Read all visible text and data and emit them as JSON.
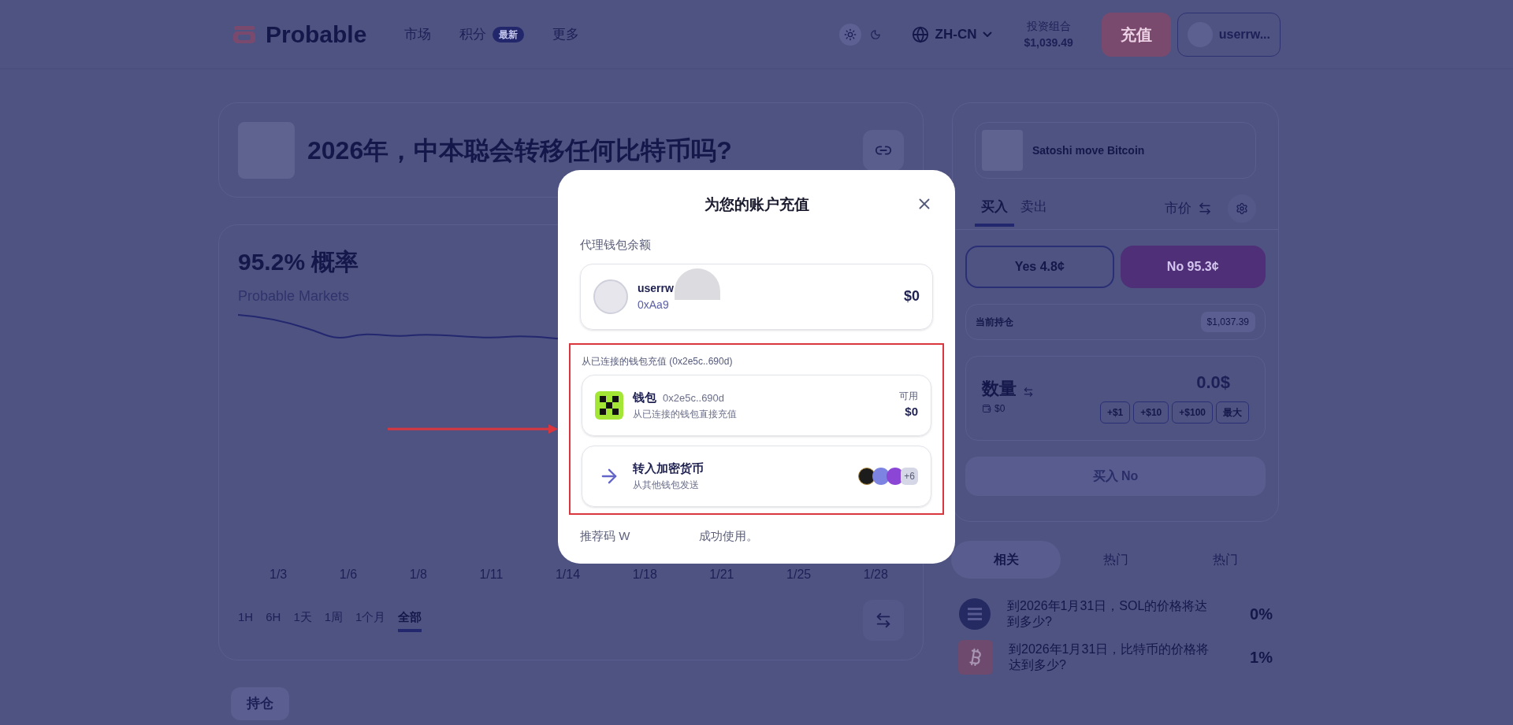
{
  "header": {
    "logo": "Probable",
    "nav": [
      {
        "label": "市场"
      },
      {
        "label": "积分",
        "badge": "最新"
      },
      {
        "label": "更多"
      }
    ],
    "dark_theme": false,
    "language": "ZH-CN",
    "portfolio_label": "投资组合",
    "portfolio_value": "$1,039.49",
    "deposit": "充值",
    "user": "userrw..."
  },
  "market": {
    "title": "2026年，中本聪会转移任何比特币吗?",
    "probability": "95.2% 概率",
    "chart_watermark": "Probable Markets",
    "x_labels": [
      "1/3",
      "1/6",
      "1/8",
      "1/11",
      "1/14",
      "1/18",
      "1/21",
      "1/25",
      "1/28"
    ],
    "ranges": [
      {
        "label": "1H",
        "selected": false
      },
      {
        "label": "6H",
        "selected": false
      },
      {
        "label": "1天",
        "selected": false
      },
      {
        "label": "1周",
        "selected": false
      },
      {
        "label": "1个月",
        "selected": false
      },
      {
        "label": "全部",
        "selected": true
      }
    ],
    "positions_tab": "持仓"
  },
  "trade": {
    "title": "Satoshi move Bitcoin",
    "sides": [
      {
        "label": "买入",
        "selected": true
      },
      {
        "label": "卖出",
        "selected": false
      }
    ],
    "order_type": "市价",
    "outcomes": [
      {
        "label": "Yes 4.8¢",
        "selected": false
      },
      {
        "label": "No 95.3¢",
        "selected": true
      }
    ],
    "holding_label": "当前持仓",
    "holding_value": "$1,037.39",
    "amount_label": "数量",
    "balance": "$0",
    "amount": "0.0$",
    "quick": [
      "+$1",
      "+$10",
      "+$100",
      "最大"
    ],
    "submit": "买入 No"
  },
  "related": {
    "tabs": [
      {
        "label": "相关",
        "selected": true
      },
      {
        "label": "热门",
        "selected": false
      },
      {
        "label": "热门",
        "selected": false
      }
    ],
    "items": [
      {
        "kind": "sol",
        "question": "到2026年1月31日，SOL的价格将达到多少?",
        "percent": "0%"
      },
      {
        "kind": "btc",
        "question": "到2026年1月31日，比特币的价格将达到多少?",
        "percent": "1%"
      }
    ]
  },
  "modal": {
    "title": "为您的账户充值",
    "proxy_label": "代理钱包余额",
    "account": {
      "name": "userrw",
      "address": "0xAa9",
      "balance": "$0"
    },
    "connected_label": "从已连接的钱包充值 (0x2e5c..690d)",
    "options": [
      {
        "kind": "wallet",
        "title": "钱包",
        "address": "0x2e5c..690d",
        "subtitle": "从已连接的钱包直接充值",
        "available_label": "可用",
        "available": "$0"
      },
      {
        "kind": "crypto",
        "title": "转入加密货币",
        "subtitle": "从其他钱包发送",
        "more": "+6"
      }
    ],
    "referral_start": "推荐码 W",
    "referral_end": "成功使用。"
  }
}
